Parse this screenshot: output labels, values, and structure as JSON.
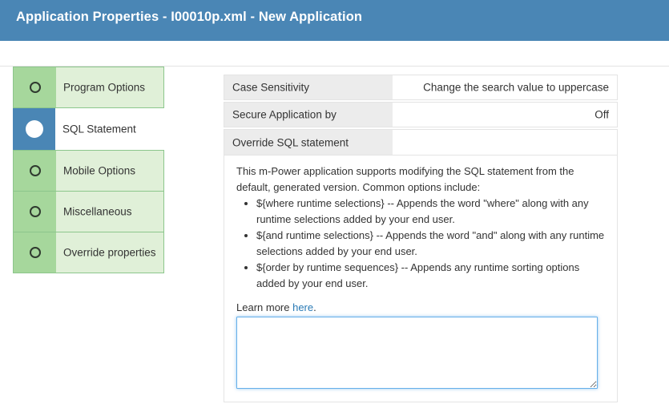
{
  "header": {
    "title": "Application Properties - I00010p.xml - New Application"
  },
  "sidebar": {
    "items": [
      {
        "label": "Program Options",
        "active": false
      },
      {
        "label": "SQL Statement",
        "active": true
      },
      {
        "label": "Mobile Options",
        "active": false
      },
      {
        "label": "Miscellaneous",
        "active": false
      },
      {
        "label": "Override properties",
        "active": false
      }
    ]
  },
  "properties": [
    {
      "label": "Case Sensitivity",
      "value": "Change the search value to uppercase"
    },
    {
      "label": "Secure Application by",
      "value": "Off"
    },
    {
      "label": "Override SQL statement",
      "value": ""
    }
  ],
  "sql": {
    "intro": "This m-Power application supports modifying the SQL statement from the default, generated version. Common options include:",
    "options": [
      "${where runtime selections} -- Appends the word \"where\" along with any runtime selections added by your end user.",
      "${and runtime selections} -- Appends the word \"and\" along with any runtime selections added by your end user.",
      "${order by runtime sequences} -- Appends any runtime sorting options added by your end user."
    ],
    "learn_more_prefix": "Learn more ",
    "learn_more_link": "here",
    "learn_more_suffix": ".",
    "textarea_value": ""
  },
  "colors": {
    "header_bg": "#4a86b5",
    "sidebar_bg": "#e0f0d8",
    "sidebar_marker": "#a6d79c",
    "sidebar_active_marker": "#4a86b5",
    "link": "#2a7ab5"
  },
  "icons": {
    "inactive_step": "circle-outline-icon",
    "active_step": "filled-circle-icon"
  }
}
